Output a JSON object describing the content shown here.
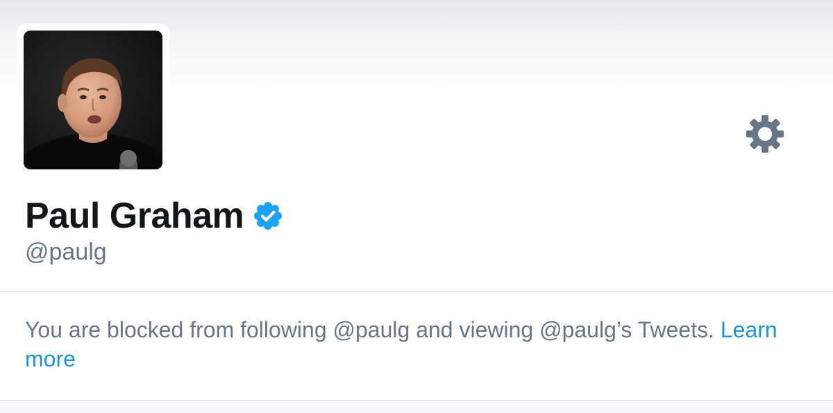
{
  "profile": {
    "display_name": "Paul Graham",
    "handle": "@paulg",
    "verified": true,
    "avatar": "profile-photo"
  },
  "header": {
    "settings_icon": "gear-icon"
  },
  "notice": {
    "text_before": "You are blocked from following @paulg and viewing @paulg’s Tweets. ",
    "link_label": "Learn more"
  },
  "colors": {
    "name_text": "#14171a",
    "secondary_text": "#657786",
    "link": "#1b95e0",
    "verified_badge": "#1da1f2",
    "gear": "#657786",
    "divider": "#d3d6da"
  }
}
